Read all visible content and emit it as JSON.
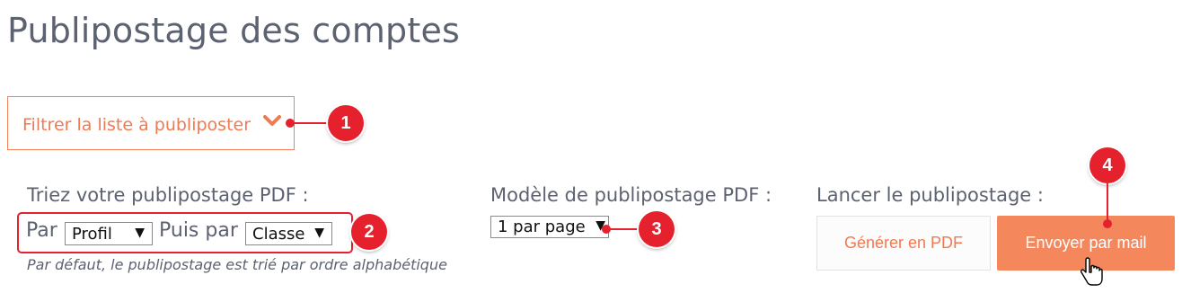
{
  "page": {
    "title": "Publipostage des comptes"
  },
  "filter": {
    "label": "Filtrer la liste à publiposter",
    "chevron_icon": "chevron-down-icon"
  },
  "sort": {
    "heading": "Triez votre publipostage PDF :",
    "par_label": "Par",
    "first_select_value": "Profil",
    "then_label": "Puis par",
    "second_select_value": "Classe",
    "hint": "Par défaut, le publipostage est trié par ordre alphabétique"
  },
  "template": {
    "heading": "Modèle de publipostage PDF :",
    "select_value": "1 par page"
  },
  "launch": {
    "heading": "Lancer le publipostage :",
    "pdf_button": "Générer en PDF",
    "mail_button": "Envoyer par mail"
  },
  "annotations": {
    "m1": "1",
    "m2": "2",
    "m3": "3",
    "m4": "4",
    "color": "#e5212e"
  },
  "colors": {
    "accent": "#f5875d",
    "accent_text": "#f07a52",
    "text": "#5c6270"
  },
  "cursor_icon": "hand-pointer-icon"
}
